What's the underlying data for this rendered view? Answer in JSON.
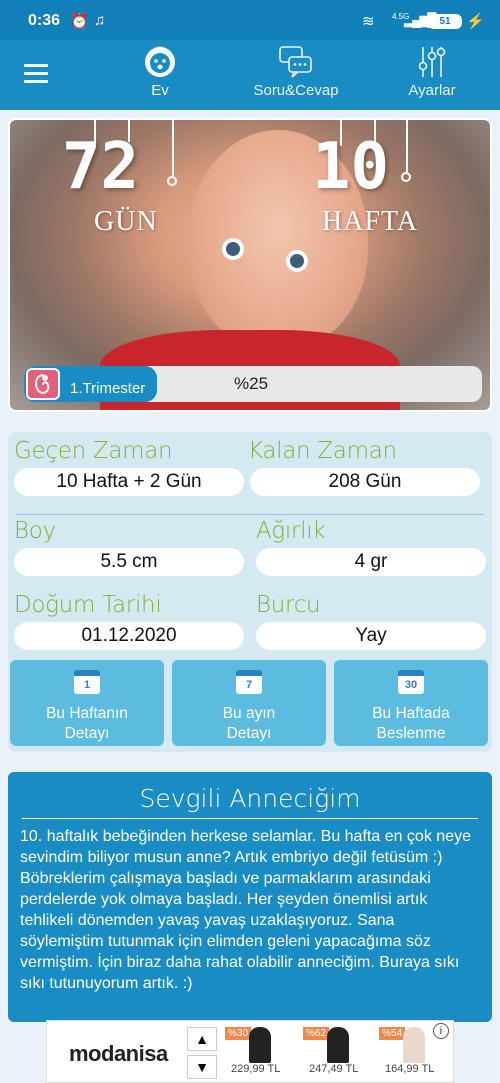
{
  "status_bar": {
    "time": "0:36",
    "battery": "51",
    "net": "4.5G"
  },
  "nav": {
    "tabs": [
      {
        "label": "Ev",
        "icon": "baby-face-icon",
        "active": true
      },
      {
        "label": "Soru&Cevap",
        "icon": "chat-bubbles-icon"
      },
      {
        "label": "Ayarlar",
        "icon": "sliders-icon"
      }
    ]
  },
  "hero": {
    "days_value": "72",
    "days_unit": "GÜN",
    "weeks_value": "10",
    "weeks_unit": "HAFTA",
    "trimester_label": "1.Trimester",
    "progress_percent_text": "%25",
    "progress_fraction": 0.25
  },
  "info": {
    "elapsed_label": "Geçen Zaman",
    "elapsed_value": "10 Hafta + 2 Gün",
    "remaining_label": "Kalan Zaman",
    "remaining_value": "208 Gün",
    "length_label": "Boy",
    "length_value": "5.5 cm",
    "weight_label": "Ağırlık",
    "weight_value": "4 gr",
    "birth_label": "Doğum Tarihi",
    "birth_value": "01.12.2020",
    "sign_label": "Burcu",
    "sign_value": "Yay"
  },
  "buttons": [
    {
      "cal": "1",
      "line1": "Bu Haftanın",
      "line2": "Detayı"
    },
    {
      "cal": "7",
      "line1": "Bu ayın",
      "line2": "Detayı"
    },
    {
      "cal": "30",
      "line1": "Bu Haftada",
      "line2": "Beslenme"
    }
  ],
  "message": {
    "title": "Sevgili Anneciğim",
    "body": "10. haftalık bebeğinden herkese selamlar. Bu hafta en çok neye sevindim biliyor musun anne? Artık embriyo değil fetüsüm :) Böbreklerim çalışmaya başladı ve parmaklarım arasındaki perdelerde yok olmaya başladı. Her şeyden önemlisi artık tehlikeli dönemden yavaş yavaş uzaklaşıyoruz. Sana söylemiştim tutunmak için elimden geleni yapacağıma söz vermiştim. İçin biraz daha rahat olabilir anneciğim. Buraya sıkı sıkı tutunuyorum artık. :)"
  },
  "ad": {
    "brand": "modanisa",
    "up": "▲",
    "down": "▼",
    "info": "i",
    "items": [
      {
        "discount": "%30",
        "price": "229,99 TL"
      },
      {
        "discount": "%62",
        "price": "247,49 TL"
      },
      {
        "discount": "%54",
        "price": "164,99 TL"
      }
    ]
  }
}
